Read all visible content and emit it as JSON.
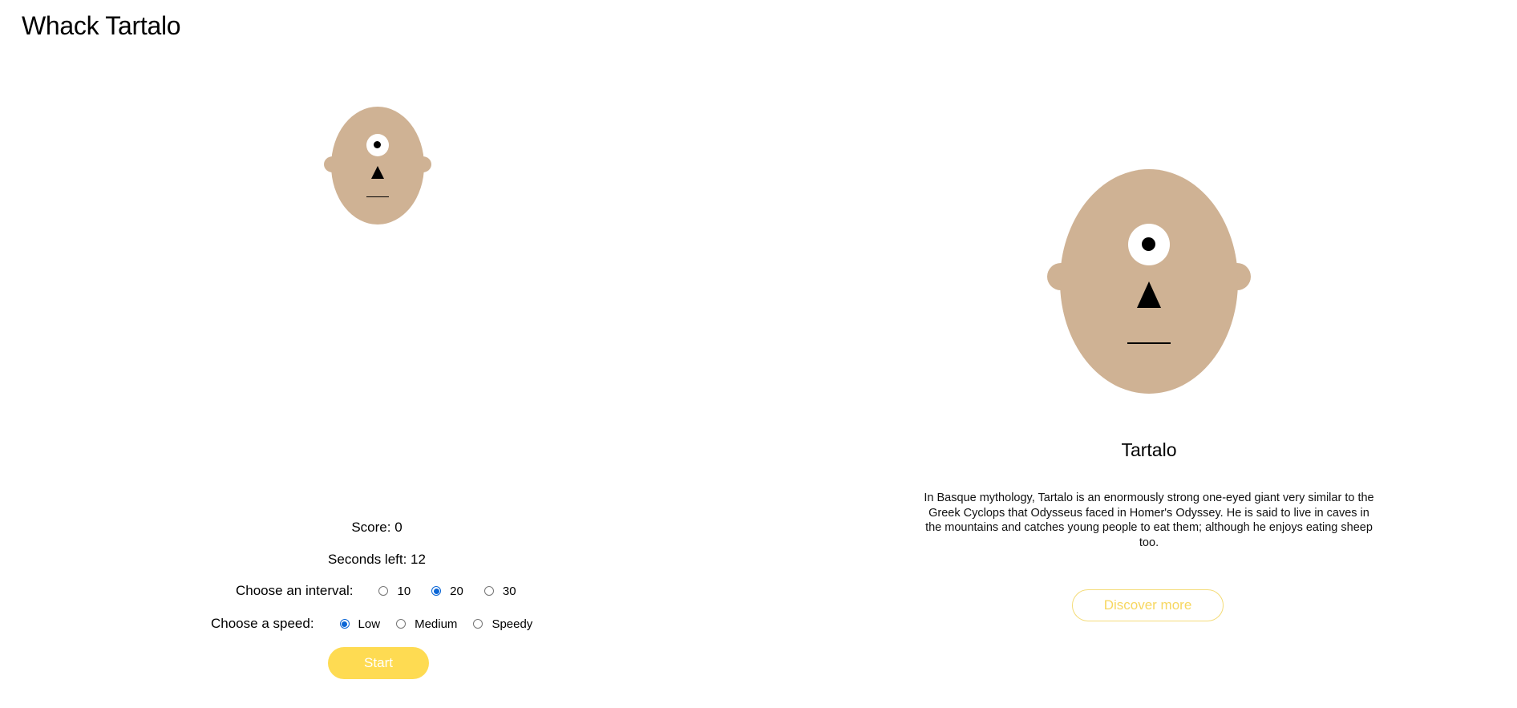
{
  "app": {
    "title": "Whack Tartalo"
  },
  "game": {
    "score_text": "Score: 0",
    "seconds_text": "Seconds left: 12",
    "interval": {
      "label": "Choose an interval:",
      "options": [
        "10",
        "20",
        "30"
      ],
      "selected": "20"
    },
    "speed": {
      "label": "Choose a speed:",
      "options": [
        "Low",
        "Medium",
        "Speedy"
      ],
      "selected": "Low"
    },
    "start_label": "Start"
  },
  "info": {
    "name": "Tartalo",
    "description": "In Basque mythology, Tartalo is an enormously strong one-eyed giant very similar to the Greek Cyclops that Odysseus faced in Homer's Odyssey. He is said to live in caves in the mountains and catches young people to eat them; although he enjoys eating sheep too.",
    "discover_label": "Discover more"
  },
  "colors": {
    "skin": "#cfb294",
    "accent_yellow": "#fedb52",
    "radio_blue": "#0b66d6"
  }
}
